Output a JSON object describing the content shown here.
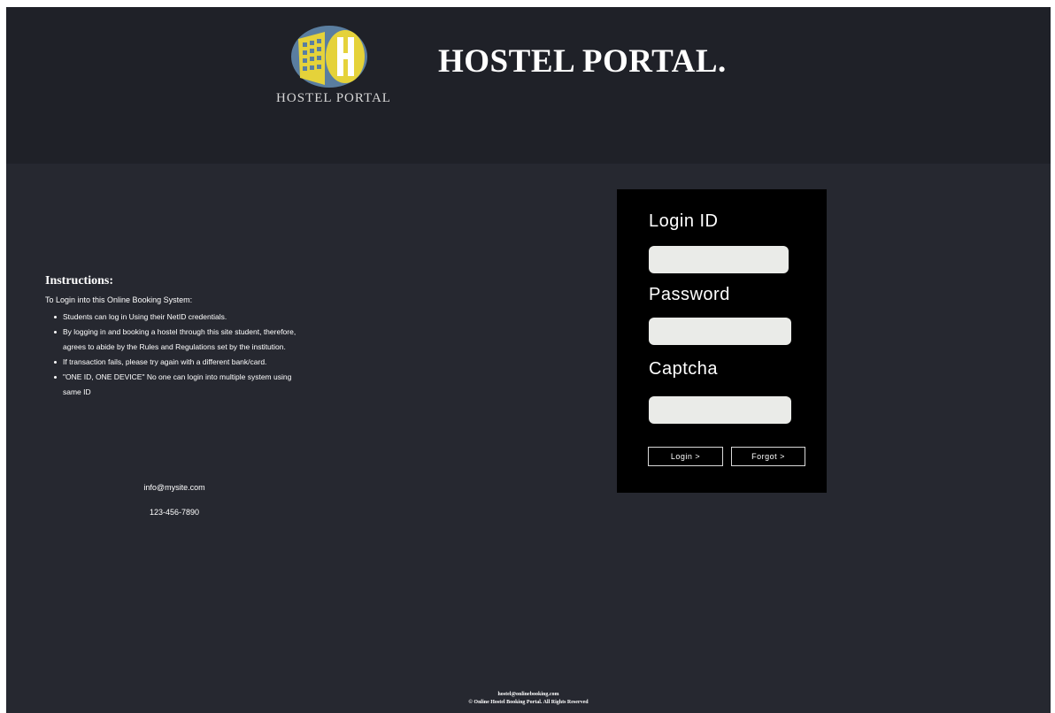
{
  "header": {
    "logo_caption": "HOSTEL PORTAL",
    "title": "HOSTEL PORTAL."
  },
  "instructions": {
    "heading": "Instructions:",
    "intro": "To Login into this Online Booking System:",
    "items": [
      "Students can log in Using their NetID credentials.",
      "By logging in and booking a hostel through this site student, therefore, agrees to abide by the Rules and Regulations set by the institution.",
      "If transaction fails, please try again with a different bank/card.",
      "\"ONE ID, ONE DEVICE\" No one can login into multiple system using same ID"
    ]
  },
  "contact": {
    "email": "info@mysite.com",
    "phone": "123-456-7890"
  },
  "login": {
    "login_id_label": "Login ID",
    "password_label": "Password",
    "captcha_label": "Captcha",
    "login_id_value": "",
    "password_value": "",
    "captcha_value": "",
    "login_button": "Login >",
    "forgot_button": "Forgot >"
  },
  "footer": {
    "email": "hostel@onlinebooking.com",
    "copyright": "© Online Hostel Booking Portal. All Rights Reserved"
  },
  "colors": {
    "header_bg": "#1f2128",
    "page_bg": "#262830",
    "login_box_bg": "#000000",
    "field_bg": "#eaebe8",
    "logo_blue": "#5a7ea0",
    "logo_yellow": "#e5d23a"
  },
  "icons": {
    "logo": "hostel-building-logo-icon"
  }
}
